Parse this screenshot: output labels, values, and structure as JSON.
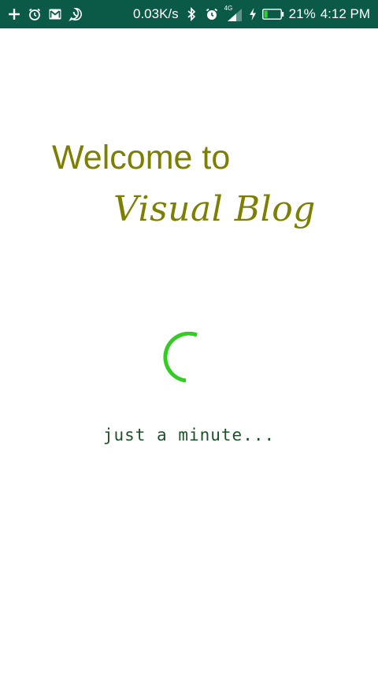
{
  "status_bar": {
    "background_color": "#0a5a47",
    "left_icons": [
      "plus-icon",
      "alarm-icon",
      "gmail-icon",
      "whatsapp-icon"
    ],
    "network_speed": "0.03K/s",
    "right_icons": [
      "bluetooth-icon",
      "alarm-icon",
      "signal-4g-icon",
      "charging-bolt-icon",
      "battery-icon"
    ],
    "network_type": "4G",
    "battery_level": 0.21,
    "battery_percent": "21%",
    "time": "4:12 PM"
  },
  "splash": {
    "welcome_text": "Welcome to",
    "brand_name": "Visual Blog",
    "accent_color": "#7d7f00",
    "spinner_color": "#33cc22",
    "loading_text": "just a minute..."
  }
}
